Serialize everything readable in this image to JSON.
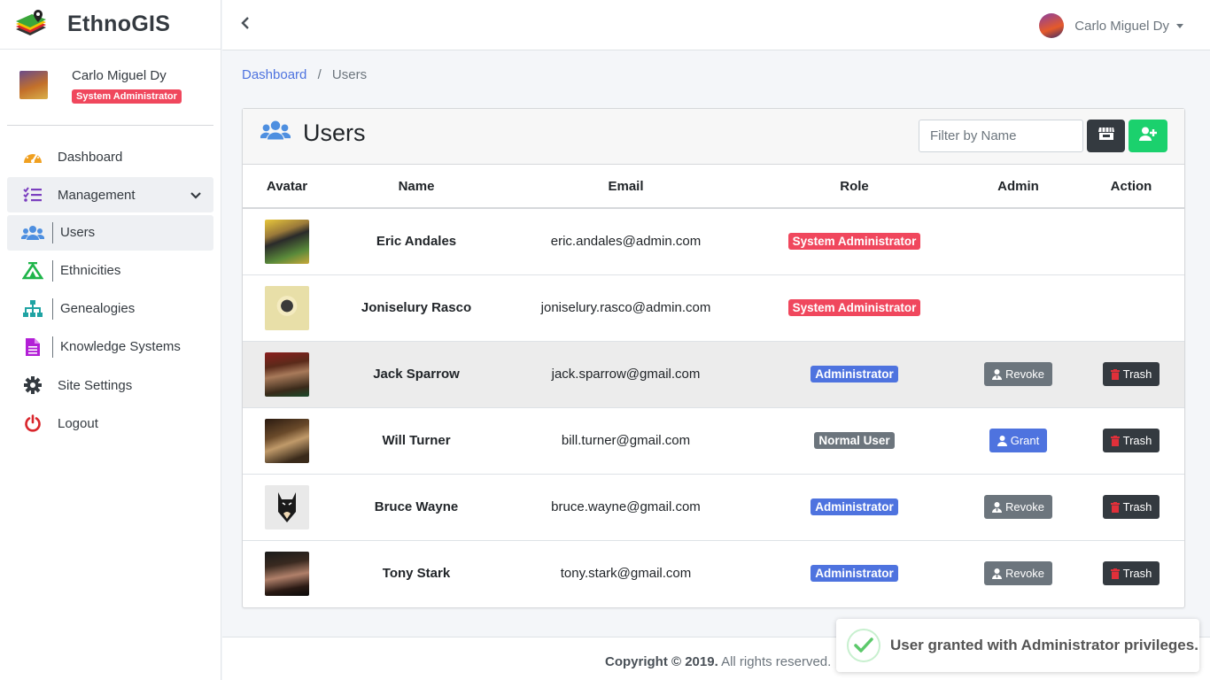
{
  "app": {
    "title": "EthnoGIS"
  },
  "user_panel": {
    "name": "Carlo Miguel Dy",
    "role": "System Administrator"
  },
  "nav": {
    "dashboard": "Dashboard",
    "management": "Management",
    "users": "Users",
    "ethnicities": "Ethnicities",
    "genealogies": "Genealogies",
    "knowledge_systems": "Knowledge Systems",
    "site_settings": "Site Settings",
    "logout": "Logout"
  },
  "topbar": {
    "user_name": "Carlo Miguel Dy"
  },
  "breadcrumb": {
    "home": "Dashboard",
    "separator": "/",
    "current": "Users"
  },
  "card": {
    "title": "Users",
    "filter_placeholder": "Filter by Name"
  },
  "table": {
    "headers": {
      "avatar": "Avatar",
      "name": "Name",
      "email": "Email",
      "role": "Role",
      "admin": "Admin",
      "action": "Action"
    },
    "rows": [
      {
        "name": "Eric Andales",
        "email": "eric.andales@admin.com",
        "role": "System Administrator",
        "admin_action": "",
        "action": ""
      },
      {
        "name": "Joniselury Rasco",
        "email": "joniselury.rasco@admin.com",
        "role": "System Administrator",
        "admin_action": "",
        "action": ""
      },
      {
        "name": "Jack Sparrow",
        "email": "jack.sparrow@gmail.com",
        "role": "Administrator",
        "admin_action": "Revoke",
        "action": "Trash"
      },
      {
        "name": "Will Turner",
        "email": "bill.turner@gmail.com",
        "role": "Normal User",
        "admin_action": "Grant",
        "action": "Trash"
      },
      {
        "name": "Bruce Wayne",
        "email": "bruce.wayne@gmail.com",
        "role": "Administrator",
        "admin_action": "Revoke",
        "action": "Trash"
      },
      {
        "name": "Tony Stark",
        "email": "tony.stark@gmail.com",
        "role": "Administrator",
        "admin_action": "Revoke",
        "action": "Trash"
      }
    ]
  },
  "footer": {
    "copyright": "Copyright © 2019.",
    "rights": " All rights reserved."
  },
  "toast": {
    "message": "User granted with Administrator privileges."
  },
  "colors": {
    "primary": "#4e73df",
    "danger": "#f0475d",
    "success": "#1bd16d",
    "dark": "#343a40",
    "secondary": "#6c757d"
  },
  "icons": {
    "brand": "map-pin-layers-icon",
    "dashboard": "speedometer-icon",
    "management": "list-check-icon",
    "users": "users-icon",
    "ethnicities": "tent-icon",
    "genealogies": "sitemap-icon",
    "knowledge_systems": "file-icon",
    "site_settings": "gear-icon",
    "logout": "power-icon"
  }
}
